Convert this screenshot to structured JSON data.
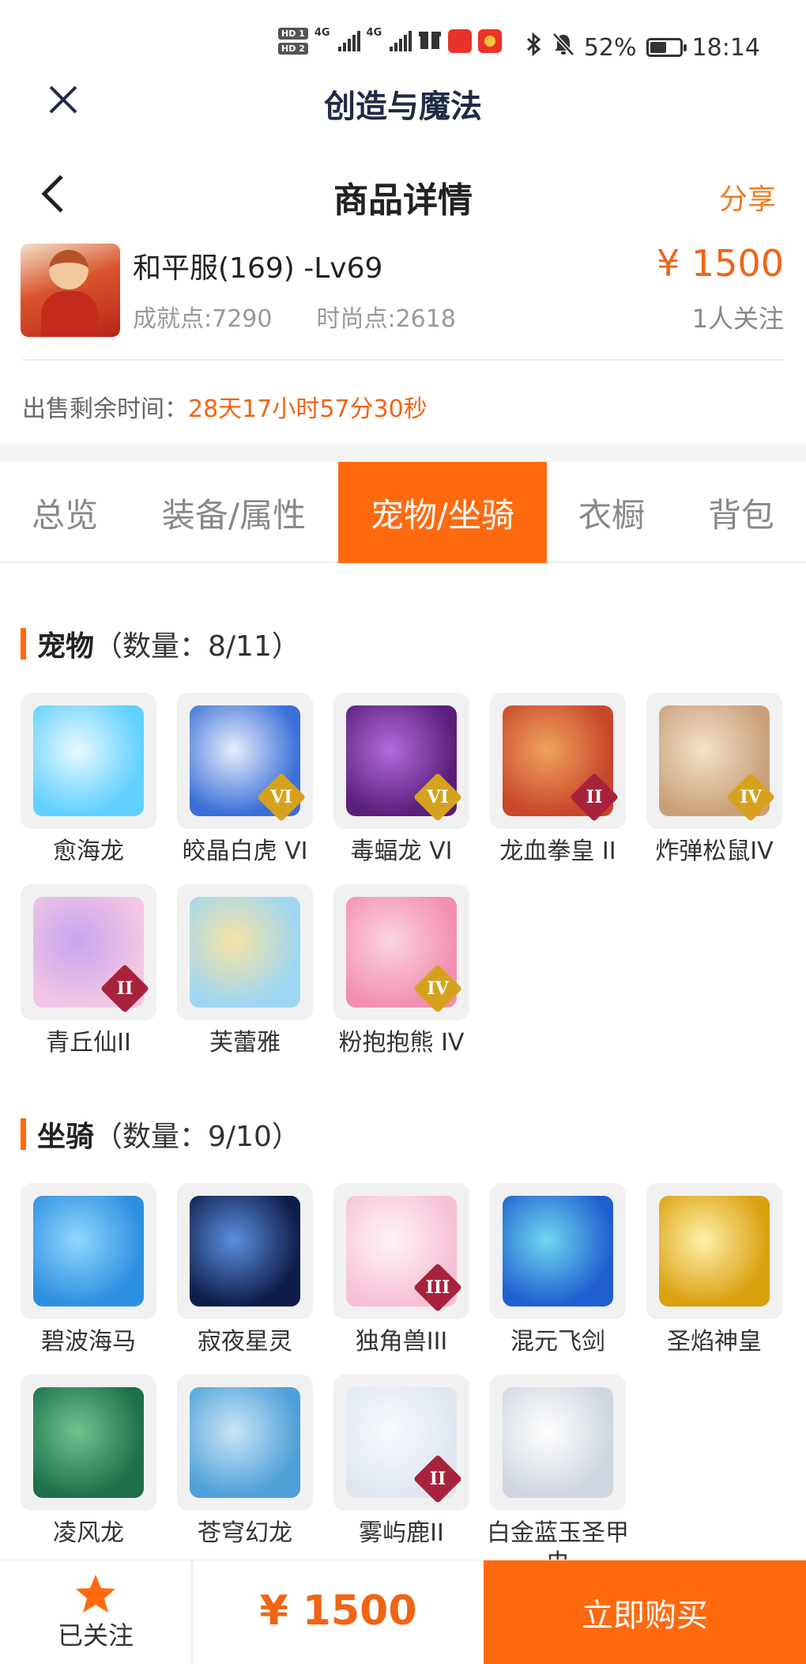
{
  "status_bar": {
    "hd1": "HD 1",
    "hd2": "HD 2",
    "net1": "4G",
    "net2": "4G",
    "battery": "52%",
    "time": "18:14"
  },
  "app": {
    "title": "创造与魔法"
  },
  "nav": {
    "title": "商品详情",
    "share": "分享"
  },
  "product": {
    "name": "和平服(169) -Lv69",
    "achievement": "成就点:7290",
    "fashion": "时尚点:2618",
    "price": "¥ 1500",
    "followers": "1人关注",
    "remaining_label": "出售剩余时间：",
    "remaining_value": "28天17小时57分30秒"
  },
  "tabs": [
    "总览",
    "装备/属性",
    "宠物/坐骑",
    "衣橱",
    "背包"
  ],
  "active_tab": 2,
  "pets": {
    "title": "宠物",
    "count": "（数量：8/11）",
    "items": [
      {
        "name": "愈海龙",
        "badge": "",
        "color1": "#5fd0ff",
        "color2": "#e8f8ff"
      },
      {
        "name": "皎晶白虎 VI",
        "badge": "VI",
        "color1": "#3a6fd8",
        "color2": "#e6eefc"
      },
      {
        "name": "毒蝠龙 VI",
        "badge": "VI",
        "color1": "#5a1f7a",
        "color2": "#b36ae0"
      },
      {
        "name": "龙血拳皇 II",
        "badge": "II",
        "color1": "#c8462a",
        "color2": "#f0a35c"
      },
      {
        "name": "炸弹松鼠IV",
        "badge": "IV",
        "color1": "#caa07a",
        "color2": "#f5e2c8"
      },
      {
        "name": "青丘仙II",
        "badge": "II",
        "color1": "#f2c7e4",
        "color2": "#c9a2f0"
      },
      {
        "name": "芙蕾雅",
        "badge": "",
        "color1": "#9fd7f2",
        "color2": "#f6e3a4"
      },
      {
        "name": "粉抱抱熊 IV",
        "badge": "IV",
        "color1": "#f28fb1",
        "color2": "#fbd4e1"
      }
    ]
  },
  "mounts": {
    "title": "坐骑",
    "count": "（数量：9/10）",
    "items": [
      {
        "name": "碧波海马",
        "badge": "",
        "color1": "#2d8fe0",
        "color2": "#8fd7ff"
      },
      {
        "name": "寂夜星灵",
        "badge": "",
        "color1": "#0e1e4a",
        "color2": "#5c8fe0"
      },
      {
        "name": "独角兽III",
        "badge": "III",
        "color1": "#f7c0d6",
        "color2": "#fff4f8"
      },
      {
        "name": "混元飞剑",
        "badge": "",
        "color1": "#1f5fd0",
        "color2": "#6fd8f0"
      },
      {
        "name": "圣焰神皇",
        "badge": "",
        "color1": "#d9a00f",
        "color2": "#fff0a8"
      },
      {
        "name": "凌风龙",
        "badge": "",
        "color1": "#1f6f4a",
        "color2": "#6fc48f"
      },
      {
        "name": "苍穹幻龙",
        "badge": "",
        "color1": "#4fa0d8",
        "color2": "#c8e6f7"
      },
      {
        "name": "雾屿鹿II",
        "badge": "II",
        "color1": "#dfe6f0",
        "color2": "#f8fbff"
      },
      {
        "name": "白金蓝玉圣甲虫",
        "badge": "",
        "color1": "#cfd6e0",
        "color2": "#ffffff"
      }
    ]
  },
  "bottom": {
    "follow_label": "已关注",
    "price": "¥ 1500",
    "buy_label": "立即购买"
  },
  "colors": {
    "accent": "#ff6a0f",
    "price": "#f06416",
    "badge_red": "#a8223b",
    "badge_gold": "#d6a21e"
  }
}
